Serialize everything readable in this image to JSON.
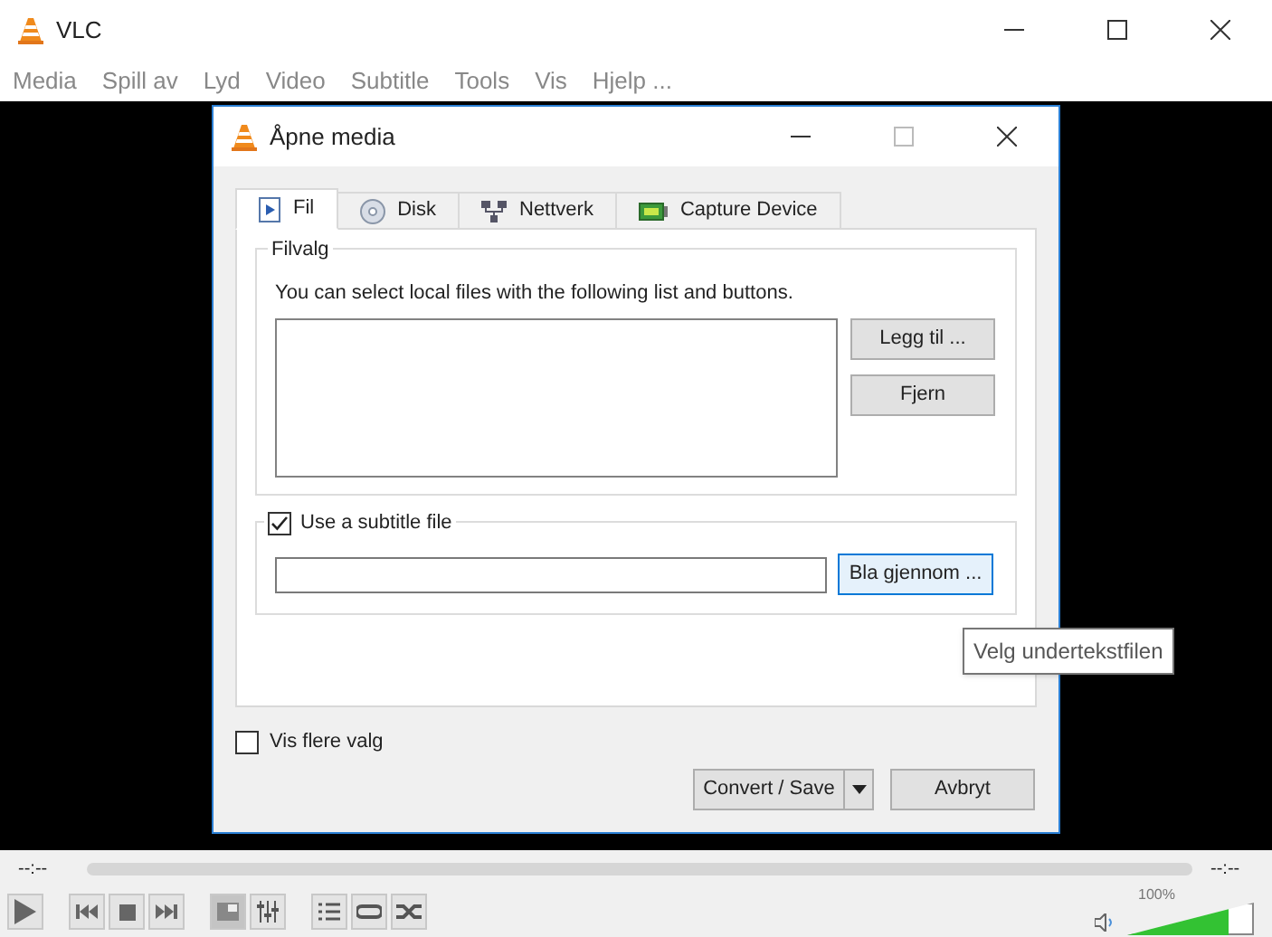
{
  "window": {
    "title": "VLC"
  },
  "menu": [
    "Media",
    "Spill av",
    "Lyd",
    "Video",
    "Subtitle",
    "Tools",
    "Vis",
    "Hjelp ..."
  ],
  "dialog": {
    "title": "Åpne media",
    "tabs": [
      {
        "label": "Fil",
        "kind": "file",
        "selected": true
      },
      {
        "label": "Disk",
        "kind": "disc",
        "selected": false
      },
      {
        "label": "Nettverk",
        "kind": "network",
        "selected": false
      },
      {
        "label": "Capture Device",
        "kind": "capture",
        "selected": false
      }
    ],
    "file_group": {
      "title": "Filvalg",
      "description": "You can select local files with the following list and buttons.",
      "buttons": [
        "Legg til ...",
        "Fjern"
      ]
    },
    "subtitle": {
      "label": "Use a subtitle file",
      "checked": true,
      "browse_button": "Bla gjennom ..."
    },
    "more_options": {
      "label": "Vis flere valg",
      "checked": false
    },
    "buttons": {
      "convert": "Convert / Save",
      "cancel": "Avbryt"
    }
  },
  "tooltip": "Velg undertekstfilen",
  "player": {
    "elapsed": "--:--",
    "remaining": "--:--",
    "volume": {
      "reading": "100%",
      "level": 0.8
    }
  }
}
